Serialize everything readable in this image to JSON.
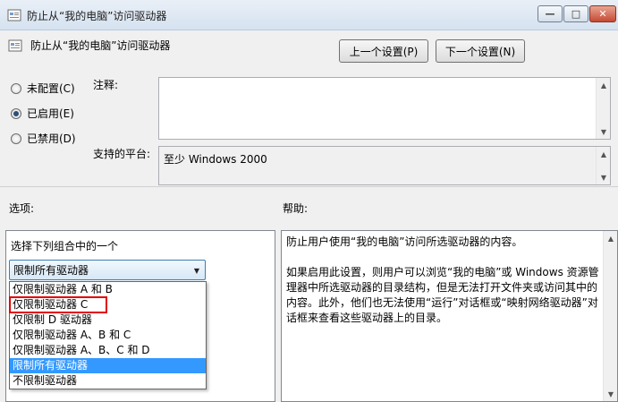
{
  "window": {
    "title": "防止从“我的电脑”访问驱动器",
    "min_glyph": "—",
    "max_glyph": "□",
    "close_glyph": "✕"
  },
  "header": {
    "title": "防止从“我的电脑”访问驱动器",
    "prev_button": "上一个设置(P)",
    "next_button": "下一个设置(N)"
  },
  "state": {
    "options": [
      {
        "label": "未配置(C)",
        "checked": false
      },
      {
        "label": "已启用(E)",
        "checked": true
      },
      {
        "label": "已禁用(D)",
        "checked": false
      }
    ]
  },
  "comment": {
    "label": "注释:",
    "value": ""
  },
  "platform": {
    "label": "支持的平台:",
    "value": "至少 Windows 2000"
  },
  "options_section": {
    "label": "选项:",
    "prompt": "选择下列组合中的一个",
    "selected_value": "限制所有驱动器",
    "items": [
      "仅限制驱动器 A 和 B",
      "仅限制驱动器 C",
      "仅限制 D 驱动器",
      "仅限制驱动器 A、B 和 C",
      "仅限制驱动器 A、B、C 和 D",
      "限制所有驱动器",
      "不限制驱动器"
    ]
  },
  "help_section": {
    "label": "帮助:",
    "paragraphs": [
      "防止用户使用“我的电脑”访问所选驱动器的内容。",
      "如果启用此设置，则用户可以浏览“我的电脑”或 Windows 资源管理器中所选驱动器的目录结构，但是无法打开文件夹或访问其中的内容。此外，他们也无法使用“运行”对话框或“映射网络驱动器”对话框来查看这些驱动器上的目录。"
    ]
  },
  "colors": {
    "accent": "#3399ff",
    "highlight_border": "#e00000"
  },
  "icons": {
    "app": "policy-setting-icon"
  }
}
